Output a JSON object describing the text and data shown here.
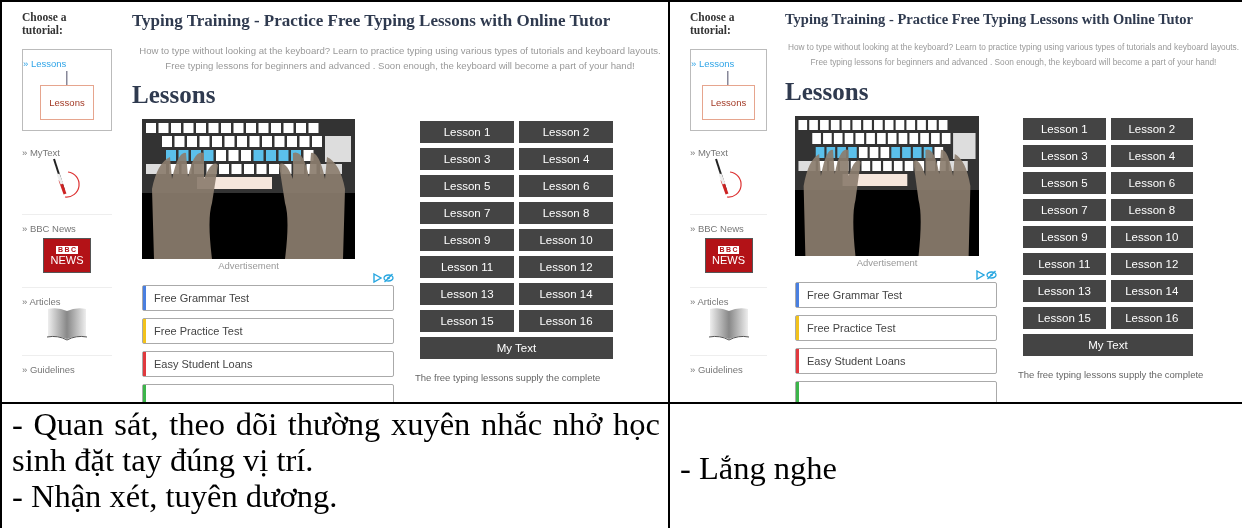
{
  "table": {
    "rows": [
      {
        "cells": [
          {
            "kind": "screenshot",
            "page": {
              "sidebar": {
                "heading": "Choose a tutorial:",
                "items": [
                  {
                    "kind": "lessons",
                    "label": "» Lessons",
                    "icon_label": "Lessons",
                    "selected": true
                  },
                  {
                    "kind": "mytext",
                    "label": "» MyText",
                    "selected": false
                  },
                  {
                    "kind": "news",
                    "label": "» BBC News",
                    "logo_top": "BBC",
                    "logo_bottom": "NEWS",
                    "selected": false
                  },
                  {
                    "kind": "articles",
                    "label": "» Articles",
                    "selected": false
                  },
                  {
                    "kind": "guidelines",
                    "label": "» Guidelines",
                    "selected": false
                  }
                ]
              },
              "title": "Typing Training - Practice Free Typing Lessons with Online Tutor",
              "intro": "How to type without looking at the keyboard? Learn to practice typing using various types of tutorials and keyboard layouts. Free typing lessons for beginners and advanced . Soon enough, the keyboard will become a part of your hand!",
              "heading": "Lessons",
              "ad_caption": "Advertisement",
              "ads": [
                {
                  "label": "Free Grammar Test",
                  "color": "#4a7fe0"
                },
                {
                  "label": "Free Practice Test",
                  "color": "#f2c21b"
                },
                {
                  "label": "Easy Student Loans",
                  "color": "#e0393e"
                },
                {
                  "color": "#3cb54a"
                }
              ],
              "lessons": [
                "Lesson 1",
                "Lesson 2",
                "Lesson 3",
                "Lesson 4",
                "Lesson 5",
                "Lesson 6",
                "Lesson 7",
                "Lesson 8",
                "Lesson 9",
                "Lesson 10",
                "Lesson 11",
                "Lesson 12",
                "Lesson 13",
                "Lesson 14",
                "Lesson 15",
                "Lesson 16"
              ],
              "my_text": "My Text",
              "footer": "The free typing lessons supply the complete"
            }
          },
          {
            "kind": "screenshot",
            "page": {
              "sidebar": {
                "heading": "Choose a tutorial:",
                "items": [
                  {
                    "kind": "lessons",
                    "label": "» Lessons",
                    "icon_label": "Lessons",
                    "selected": true
                  },
                  {
                    "kind": "mytext",
                    "label": "» MyText",
                    "selected": false
                  },
                  {
                    "kind": "news",
                    "label": "» BBC News",
                    "logo_top": "BBC",
                    "logo_bottom": "NEWS",
                    "selected": false
                  },
                  {
                    "kind": "articles",
                    "label": "» Articles",
                    "selected": false
                  },
                  {
                    "kind": "guidelines",
                    "label": "» Guidelines",
                    "selected": false
                  }
                ]
              },
              "title": "Typing Training - Practice Free Typing Lessons with Online Tutor",
              "intro": "How to type without looking at the keyboard? Learn to practice typing using various types of tutorials and keyboard layouts. Free typing lessons for beginners and advanced . Soon enough, the keyboard will become a part of your hand!",
              "heading": "Lessons",
              "ad_caption": "Advertisement",
              "ads": [
                {
                  "label": "Free Grammar Test",
                  "color": "#4a7fe0"
                },
                {
                  "label": "Free Practice Test",
                  "color": "#f2c21b"
                },
                {
                  "label": "Easy Student Loans",
                  "color": "#e0393e"
                },
                {
                  "color": "#3cb54a"
                }
              ],
              "lessons": [
                "Lesson 1",
                "Lesson 2",
                "Lesson 3",
                "Lesson 4",
                "Lesson 5",
                "Lesson 6",
                "Lesson 7",
                "Lesson 8",
                "Lesson 9",
                "Lesson 10",
                "Lesson 11",
                "Lesson 12",
                "Lesson 13",
                "Lesson 14",
                "Lesson 15",
                "Lesson 16"
              ],
              "my_text": "My Text",
              "footer": "The free typing lessons supply the complete"
            }
          }
        ]
      },
      {
        "cells": [
          {
            "kind": "text",
            "lines": [
              "- Quan sát, theo dõi thường xuyên nhắc nhở học sinh đặt tay đúng vị trí.",
              "- Nhận xét, tuyên dương."
            ]
          },
          {
            "kind": "text",
            "lines": [
              "- Lắng nghe"
            ]
          }
        ]
      }
    ]
  }
}
